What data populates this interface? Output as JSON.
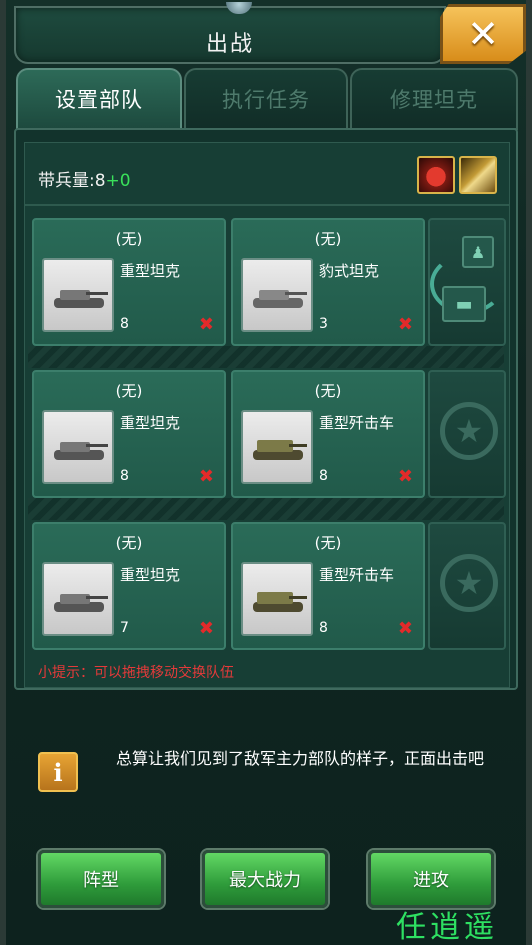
{
  "window": {
    "title": "出战",
    "close_label": "✕"
  },
  "tabs": [
    {
      "label": "设置部队",
      "active": true
    },
    {
      "label": "执行任务",
      "active": false
    },
    {
      "label": "修理坦克",
      "active": false
    }
  ],
  "troops": {
    "label": "带兵量:8",
    "bonus": "+0"
  },
  "buffs": [
    {
      "icon": "potion-buff-icon"
    },
    {
      "icon": "shell-buff-icon"
    }
  ],
  "rows": [
    {
      "slots": [
        {
          "general": "(无)",
          "unit_name": "重型坦克",
          "count": "8",
          "remove": "✖"
        },
        {
          "general": "(无)",
          "unit_name": "豹式坦克",
          "count": "3",
          "remove": "✖"
        }
      ]
    },
    {
      "slots": [
        {
          "general": "(无)",
          "unit_name": "重型坦克",
          "count": "8",
          "remove": "✖"
        },
        {
          "general": "(无)",
          "unit_name": "重型歼击车",
          "count": "8",
          "remove": "✖"
        }
      ]
    },
    {
      "slots": [
        {
          "general": "(无)",
          "unit_name": "重型坦克",
          "count": "7",
          "remove": "✖"
        },
        {
          "general": "(无)",
          "unit_name": "重型歼击车",
          "count": "8",
          "remove": "✖"
        }
      ]
    }
  ],
  "hint": "小提示：可以拖拽移动交换队伍",
  "info": {
    "icon_label": "i",
    "text": "总算让我们见到了敌军主力部队的样子，正面出击吧"
  },
  "buttons": {
    "formation": "阵型",
    "max_power": "最大战力",
    "attack": "进攻"
  },
  "watermark": "任逍遥",
  "colors": {
    "accent_green": "#39e05a",
    "hint_red": "#e53a3a",
    "close_orange": "#e9a32f"
  }
}
